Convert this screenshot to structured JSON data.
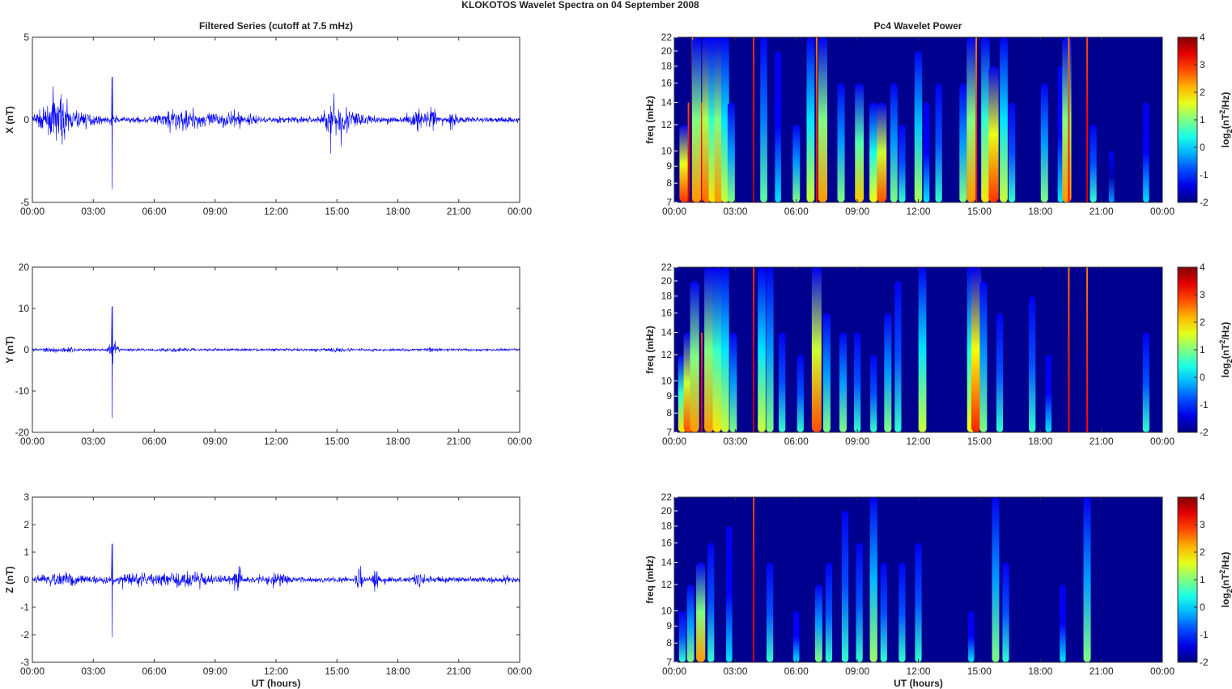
{
  "title": "KLOKOTOS Wavelet Spectra on 04 September 2008",
  "chart_data": [
    {
      "type": "line",
      "title": "Filtered Series (cutoff at 7.5 mHz)",
      "xlabel": "",
      "ylabel": "X (nT)",
      "xlim": [
        0,
        24
      ],
      "ylim": [
        -5,
        5
      ],
      "yticks": [
        -5,
        0,
        5
      ],
      "xticks": [
        "00:00",
        "03:00",
        "06:00",
        "09:00",
        "12:00",
        "15:00",
        "18:00",
        "21:00",
        "00:00"
      ],
      "color": "#0000FF",
      "baseline_amplitude": 0.15,
      "bursts": [
        [
          0.8,
          1.2,
          0.8
        ],
        [
          1.3,
          0.5,
          1.3
        ],
        [
          2.3,
          1.0,
          0.6
        ],
        [
          3.93,
          0.03,
          4.5
        ],
        [
          7.0,
          1.2,
          0.7
        ],
        [
          8.5,
          2.0,
          0.4
        ],
        [
          10.2,
          1.0,
          0.4
        ],
        [
          14.8,
          0.6,
          1.2
        ],
        [
          15.6,
          1.0,
          0.8
        ],
        [
          19.0,
          0.5,
          0.8
        ],
        [
          19.7,
          0.3,
          0.9
        ],
        [
          20.7,
          0.2,
          1.0
        ]
      ]
    },
    {
      "type": "line",
      "xlabel": "",
      "ylabel": "Y (nT)",
      "xlim": [
        0,
        24
      ],
      "ylim": [
        -20,
        20
      ],
      "yticks": [
        -20,
        -10,
        0,
        10,
        20
      ],
      "xticks": [
        "00:00",
        "03:00",
        "06:00",
        "09:00",
        "12:00",
        "15:00",
        "18:00",
        "21:00",
        "00:00"
      ],
      "color": "#0000FF",
      "baseline_amplitude": 0.25,
      "bursts": [
        [
          1.5,
          1.5,
          0.6
        ],
        [
          3.93,
          0.03,
          17
        ],
        [
          4.0,
          0.3,
          2.5
        ],
        [
          7.0,
          1.0,
          0.5
        ],
        [
          14.9,
          0.6,
          0.6
        ],
        [
          19.7,
          0.3,
          0.5
        ]
      ]
    },
    {
      "type": "line",
      "xlabel": "UT (hours)",
      "ylabel": "Z (nT)",
      "xlim": [
        0,
        24
      ],
      "ylim": [
        -3,
        3
      ],
      "yticks": [
        -3,
        -2,
        -1,
        0,
        1,
        2,
        3
      ],
      "xticks": [
        "00:00",
        "03:00",
        "06:00",
        "09:00",
        "12:00",
        "15:00",
        "18:00",
        "21:00",
        "00:00"
      ],
      "color": "#0000FF",
      "baseline_amplitude": 0.08,
      "bursts": [
        [
          1.5,
          1.5,
          0.25
        ],
        [
          3.93,
          0.03,
          2.2
        ],
        [
          5.0,
          1.5,
          0.2
        ],
        [
          7.5,
          2.0,
          0.3
        ],
        [
          10.1,
          0.3,
          0.7
        ],
        [
          12.0,
          1.0,
          0.2
        ],
        [
          16.1,
          0.2,
          0.9
        ],
        [
          16.9,
          0.2,
          0.7
        ],
        [
          19.0,
          0.4,
          0.3
        ]
      ]
    },
    {
      "type": "heatmap",
      "title": "Pc4 Wavelet Power",
      "ylabel": "freq (mHz)",
      "xlabel": "",
      "yscale": "log",
      "ylim": [
        7,
        22
      ],
      "yticks": [
        7,
        8,
        9,
        10,
        12,
        14,
        16,
        18,
        20,
        22
      ],
      "xticks": [
        "00:00",
        "03:00",
        "06:00",
        "09:00",
        "12:00",
        "15:00",
        "18:00",
        "21:00",
        "00:00"
      ],
      "colorbar": {
        "label_main": "log",
        "label_sub": "2",
        "label_rest": "(nT",
        "label_sup": "2",
        "label_end": "/Hz)",
        "range": [
          -2,
          4
        ],
        "ticks": [
          -2,
          -1,
          0,
          1,
          2,
          3,
          4
        ]
      },
      "events": [
        [
          0.5,
          3.2,
          12
        ],
        [
          0.7,
          3.8,
          14
        ],
        [
          0.9,
          3.5,
          22
        ],
        [
          1.1,
          2.5,
          22
        ],
        [
          1.35,
          3.8,
          14
        ],
        [
          1.6,
          2.8,
          22
        ],
        [
          1.9,
          2.0,
          22
        ],
        [
          2.2,
          2.5,
          22
        ],
        [
          2.5,
          1.5,
          22
        ],
        [
          2.8,
          1.0,
          14
        ],
        [
          3.9,
          4.0,
          22
        ],
        [
          4.4,
          0.8,
          22
        ],
        [
          5.1,
          0.0,
          20
        ],
        [
          6.0,
          1.0,
          12
        ],
        [
          6.7,
          1.5,
          22
        ],
        [
          7.0,
          3.5,
          22
        ],
        [
          7.3,
          2.5,
          22
        ],
        [
          8.2,
          1.0,
          16
        ],
        [
          9.1,
          2.2,
          16
        ],
        [
          9.8,
          1.8,
          14
        ],
        [
          10.2,
          3.0,
          14
        ],
        [
          10.8,
          1.0,
          16
        ],
        [
          11.2,
          0.5,
          12
        ],
        [
          12.0,
          1.3,
          20
        ],
        [
          12.4,
          0.0,
          14
        ],
        [
          13.0,
          0.5,
          16
        ],
        [
          14.2,
          1.0,
          16
        ],
        [
          14.6,
          2.5,
          22
        ],
        [
          14.85,
          3.5,
          22
        ],
        [
          15.3,
          2.0,
          22
        ],
        [
          15.7,
          3.2,
          18
        ],
        [
          16.2,
          1.5,
          22
        ],
        [
          16.6,
          0.5,
          14
        ],
        [
          18.2,
          1.0,
          16
        ],
        [
          19.0,
          0.0,
          18
        ],
        [
          19.3,
          2.5,
          22
        ],
        [
          19.4,
          3.5,
          22
        ],
        [
          20.3,
          3.8,
          22
        ],
        [
          20.6,
          0.5,
          12
        ],
        [
          21.5,
          -0.5,
          10
        ],
        [
          23.2,
          0.0,
          14
        ]
      ]
    },
    {
      "type": "heatmap",
      "ylabel": "freq (mHz)",
      "xlabel": "",
      "yscale": "log",
      "ylim": [
        7,
        22
      ],
      "yticks": [
        7,
        8,
        9,
        10,
        12,
        14,
        16,
        18,
        20,
        22
      ],
      "xticks": [
        "00:00",
        "03:00",
        "06:00",
        "09:00",
        "12:00",
        "15:00",
        "18:00",
        "21:00",
        "00:00"
      ],
      "colorbar": {
        "label_main": "log",
        "label_sub": "2",
        "label_rest": "(nT",
        "label_sup": "2",
        "label_end": "/Hz)",
        "range": [
          -2,
          4
        ],
        "ticks": [
          -2,
          -1,
          0,
          1,
          2,
          3,
          4
        ]
      },
      "events": [
        [
          0.4,
          2.0,
          12
        ],
        [
          0.7,
          3.0,
          14
        ],
        [
          1.0,
          2.5,
          20
        ],
        [
          1.35,
          3.8,
          14
        ],
        [
          1.7,
          2.5,
          22
        ],
        [
          2.1,
          2.0,
          22
        ],
        [
          2.5,
          1.5,
          22
        ],
        [
          2.9,
          1.0,
          14
        ],
        [
          3.9,
          4.0,
          22
        ],
        [
          4.3,
          1.5,
          22
        ],
        [
          4.7,
          1.0,
          22
        ],
        [
          5.3,
          0.5,
          14
        ],
        [
          6.2,
          0.5,
          12
        ],
        [
          7.0,
          3.0,
          22
        ],
        [
          7.5,
          1.0,
          16
        ],
        [
          8.3,
          1.0,
          14
        ],
        [
          9.0,
          0.5,
          14
        ],
        [
          9.8,
          0.5,
          12
        ],
        [
          10.5,
          1.0,
          16
        ],
        [
          11.0,
          0.5,
          20
        ],
        [
          12.2,
          1.5,
          22
        ],
        [
          14.6,
          1.8,
          22
        ],
        [
          14.85,
          3.3,
          22
        ],
        [
          15.2,
          1.0,
          20
        ],
        [
          16.0,
          0.5,
          16
        ],
        [
          17.6,
          0.5,
          18
        ],
        [
          18.4,
          0.0,
          12
        ],
        [
          19.4,
          3.5,
          22
        ],
        [
          20.3,
          3.5,
          22
        ],
        [
          23.2,
          0.5,
          14
        ]
      ]
    },
    {
      "type": "heatmap",
      "ylabel": "freq (mHz)",
      "xlabel": "UT (hours)",
      "yscale": "log",
      "ylim": [
        7,
        22
      ],
      "yticks": [
        7,
        8,
        9,
        10,
        12,
        14,
        16,
        18,
        20,
        22
      ],
      "xticks": [
        "00:00",
        "03:00",
        "06:00",
        "09:00",
        "12:00",
        "15:00",
        "18:00",
        "21:00",
        "00:00"
      ],
      "colorbar": {
        "label_main": "log",
        "label_sub": "2",
        "label_rest": "(nT",
        "label_sup": "2",
        "label_end": "/Hz)",
        "range": [
          -2,
          4
        ],
        "ticks": [
          -2,
          -1,
          0,
          1,
          2,
          3,
          4
        ]
      },
      "events": [
        [
          0.4,
          0.5,
          10
        ],
        [
          0.8,
          1.0,
          12
        ],
        [
          1.3,
          2.5,
          14
        ],
        [
          1.8,
          0.5,
          16
        ],
        [
          2.7,
          0.0,
          18
        ],
        [
          3.9,
          3.8,
          22
        ],
        [
          4.7,
          0.5,
          14
        ],
        [
          6.0,
          0.0,
          10
        ],
        [
          7.1,
          1.0,
          12
        ],
        [
          7.6,
          0.5,
          14
        ],
        [
          8.4,
          0.5,
          20
        ],
        [
          9.1,
          0.5,
          16
        ],
        [
          9.8,
          1.2,
          22
        ],
        [
          10.3,
          0.5,
          14
        ],
        [
          11.2,
          0.5,
          14
        ],
        [
          12.0,
          0.5,
          16
        ],
        [
          14.6,
          0.0,
          10
        ],
        [
          15.8,
          1.0,
          22
        ],
        [
          16.3,
          0.5,
          14
        ],
        [
          19.1,
          0.0,
          12
        ],
        [
          20.3,
          1.0,
          22
        ]
      ]
    }
  ]
}
